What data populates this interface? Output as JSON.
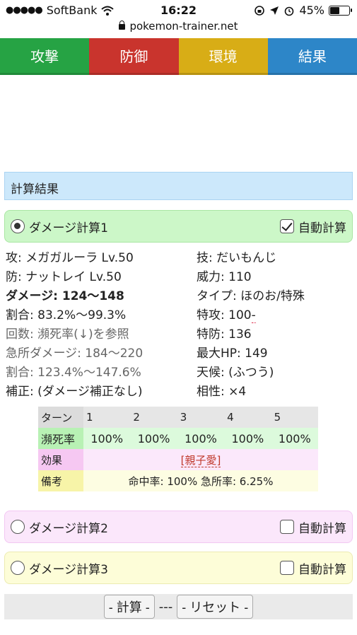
{
  "status": {
    "carrier": "SoftBank",
    "time": "16:22",
    "battery": "45%"
  },
  "url": "pokemon-trainer.net",
  "tabs": [
    "攻撃",
    "防御",
    "環境",
    "結果"
  ],
  "result_header": "計算結果",
  "calc1": {
    "title": "ダメージ計算1",
    "auto": "自動計算"
  },
  "details": {
    "left": [
      "攻: メガガルーラ Lv.50",
      "防: ナットレイ Lv.50",
      "ダメージ: 124〜148",
      "割合: 83.2%〜99.3%",
      "回数: 瀕死率(↓)を参照",
      "急所ダメージ: 184〜220",
      "割合: 123.4%〜147.6%",
      "補正: (ダメージ補正なし)"
    ],
    "right": [
      "技: だいもんじ",
      "威力: 110",
      "タイプ: ほのお/特殊",
      "特攻: 100",
      "特防: 136",
      "最大HP: 149",
      "天候: (ふつう)",
      "相性: ×4"
    ],
    "right_special_suffix": "-"
  },
  "turns": {
    "header_label": "ターン",
    "numbers": [
      "1",
      "2",
      "3",
      "4",
      "5"
    ],
    "death_label": "瀕死率",
    "death_rates": [
      "100%",
      "100%",
      "100%",
      "100%",
      "100%"
    ],
    "effect_label": "効果",
    "effect_value": "[親子愛]",
    "note_label": "備考",
    "note_value": "命中率: 100% 急所率: 6.25%"
  },
  "calc2": {
    "title": "ダメージ計算2",
    "auto": "自動計算"
  },
  "calc3": {
    "title": "ダメージ計算3",
    "auto": "自動計算"
  },
  "bottom": {
    "calc_button": "- 計算 -",
    "separator": "---",
    "reset_button": "- リセット -"
  }
}
